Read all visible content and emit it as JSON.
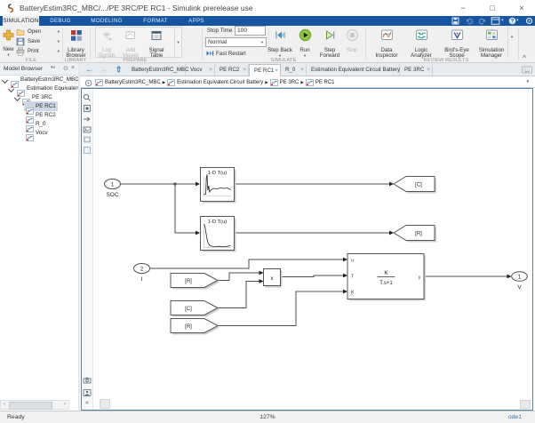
{
  "window": {
    "title": "BatteryEstim3RC_MBC/.../PE 3RC/PE RC1 - Simulink prerelease use"
  },
  "ribbon": {
    "tabs": [
      "SIMULATION",
      "DEBUG",
      "MODELING",
      "FORMAT",
      "APPS"
    ],
    "file": {
      "new": "New",
      "open": "Open",
      "save": "Save",
      "print": "Print",
      "label": "FILE"
    },
    "library": {
      "browser": "Library Browser",
      "label": "LIBRARY"
    },
    "prepare": {
      "log": "Log Signals",
      "add": "Add Viewer",
      "table": "Signal Table",
      "label": "PREPARE"
    },
    "simulate": {
      "stop_time_label": "Stop Time",
      "stop_time": "100",
      "mode": "Normal",
      "fast_restart": "Fast Restart",
      "step_back": "Step Back",
      "run": "Run",
      "step_forward": "Step Forward",
      "stop": "Stop",
      "label": "SIMULATE"
    },
    "review": {
      "data_inspector": "Data Inspector",
      "logic_analyzer": "Logic Analyzer",
      "birds_eye": "Bird's-Eye Scope",
      "sim_manager": "Simulation Manager",
      "label": "REVIEW RESULTS"
    }
  },
  "browser": {
    "title": "Model Browser",
    "tree": [
      {
        "label": "BatteryEstim3RC_MBC"
      },
      {
        "label": "Estimation Equivalent Ci"
      },
      {
        "label": "PE 3RC"
      },
      {
        "label": "PE RC1"
      },
      {
        "label": "PE RC2"
      },
      {
        "label": "R_0"
      },
      {
        "label": "Vocv"
      }
    ]
  },
  "doctabs": [
    "BatteryEstim3RC_MBC",
    "Vocv",
    "PE RC2",
    "PE RC1",
    "R_0",
    "Estimation Equivalent Circuit Battery",
    "PE 3RC"
  ],
  "breadcrumb": [
    "BatteryEstim3RC_MBC",
    "Estimation Equivalent Circuit Battery",
    "PE 3RC",
    "PE RC1"
  ],
  "diagram": {
    "inport1": {
      "num": "1",
      "label": "SOC"
    },
    "inport2": {
      "num": "2",
      "label": "I"
    },
    "lut1": "1-D T(u)",
    "lut2": "1-D T(u)",
    "goto_c": "[C]",
    "goto_r": "[R]",
    "from_r1": "[R]",
    "from_c": "[C]",
    "from_r2": "[R]",
    "mult": "x",
    "tf": {
      "num": "K",
      "den": "T.s+1",
      "in1": "u",
      "in2": "T",
      "in3": "K",
      "out": "y"
    },
    "outport": {
      "num": "1",
      "label": "V"
    }
  },
  "status": {
    "ready": "Ready",
    "zoom": "127%",
    "solver": "ode1"
  },
  "colors": {
    "toolstrip_blue": "#1656a0",
    "run_green": "#8dc63f",
    "focus_border": "#4f84ad",
    "selection": "#ccd9e5",
    "solver_link": "#3a70b0"
  }
}
